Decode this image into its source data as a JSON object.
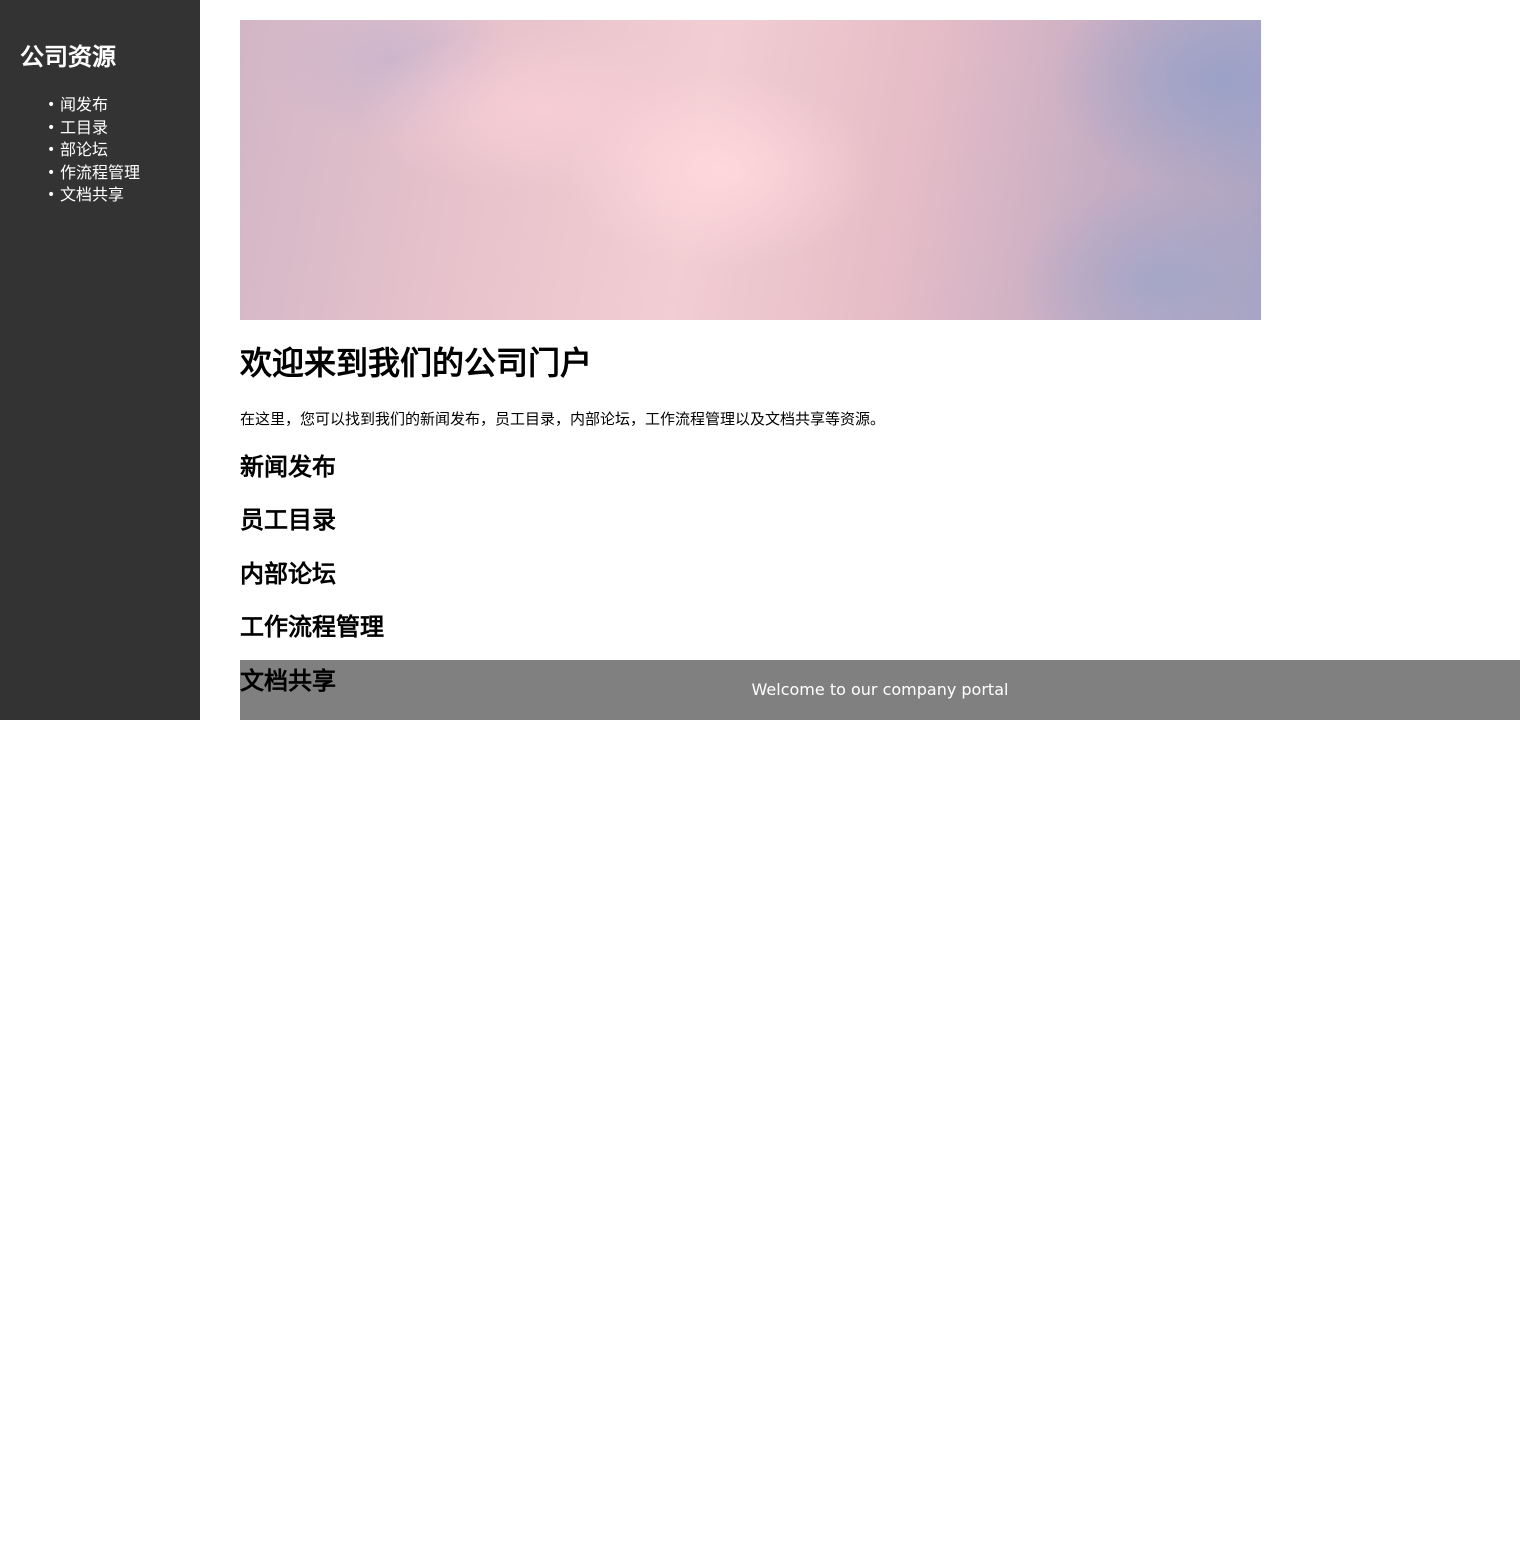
{
  "sidebar": {
    "title": "公司资源",
    "items": [
      {
        "label": "闻发布"
      },
      {
        "label": "工目录"
      },
      {
        "label": "部论坛"
      },
      {
        "label": "作流程管理"
      },
      {
        "label": "文档共享"
      }
    ],
    "bullet": "•"
  },
  "main": {
    "title": "欢迎来到我们的公司门户",
    "description": "在这里，您可以找到我们的新闻发布，员工目录，内部论坛，工作流程管理以及文档共享等资源。",
    "sections": [
      {
        "heading": "新闻发布"
      },
      {
        "heading": "员工目录"
      },
      {
        "heading": "内部论坛"
      },
      {
        "heading": "工作流程管理"
      },
      {
        "heading": "文档共享"
      }
    ]
  },
  "footer": {
    "text": "Welcome to our company portal"
  },
  "colors": {
    "sidebar_background": "#333333",
    "footer_background": "#808080",
    "text_light": "#ffffff",
    "text_dark": "#000000"
  }
}
